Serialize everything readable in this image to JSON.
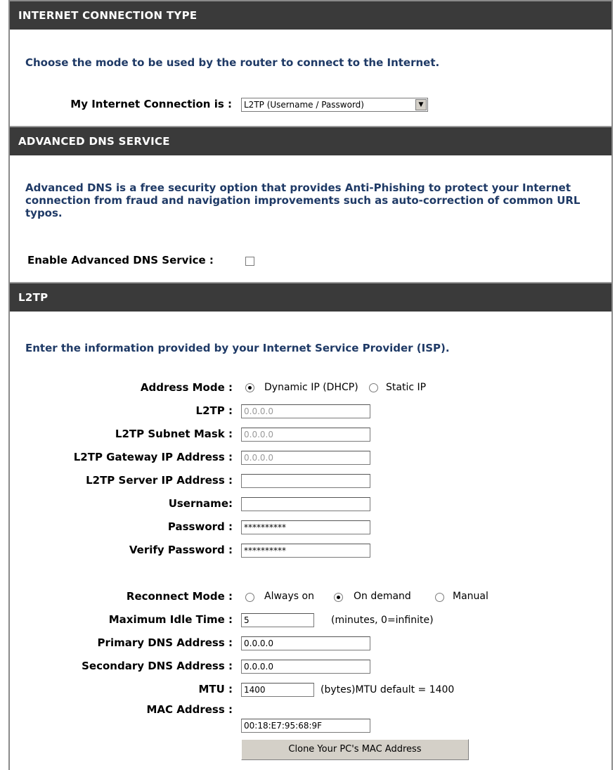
{
  "connection_type": {
    "header": "INTERNET CONNECTION TYPE",
    "description": "Choose the mode to be used by the router to connect to the Internet.",
    "label": "My Internet Connection is :",
    "selected": "L2TP (Username / Password)"
  },
  "advanced_dns": {
    "header": "ADVANCED DNS SERVICE",
    "description": "Advanced DNS is a free security option that provides Anti-Phishing to protect your Internet connection from fraud and navigation improvements such as auto-correction of common URL typos.",
    "label": "Enable Advanced DNS Service :",
    "enabled": false
  },
  "l2tp": {
    "header": "L2TP",
    "description": "Enter the information provided by your Internet Service Provider (ISP).",
    "address_mode": {
      "label": "Address Mode :",
      "options": [
        "Dynamic IP (DHCP)",
        "Static IP"
      ],
      "selected": "Dynamic IP (DHCP)"
    },
    "fields": {
      "l2tp_ip": {
        "label": "L2TP :",
        "value": "0.0.0.0"
      },
      "subnet_mask": {
        "label": "L2TP Subnet Mask :",
        "value": "0.0.0.0"
      },
      "gateway": {
        "label": "L2TP Gateway IP Address :",
        "value": "0.0.0.0"
      },
      "server": {
        "label": "L2TP Server IP Address :",
        "value": ""
      },
      "username": {
        "label": "Username:",
        "value": ""
      },
      "password": {
        "label": "Password :",
        "value": "**********"
      },
      "verify_password": {
        "label": "Verify Password :",
        "value": "**********"
      }
    },
    "reconnect_mode": {
      "label": "Reconnect Mode :",
      "options": [
        "Always on",
        "On demand",
        "Manual"
      ],
      "selected": "On demand"
    },
    "idle_time": {
      "label": "Maximum Idle Time :",
      "value": "5",
      "note": "(minutes, 0=infinite)"
    },
    "primary_dns": {
      "label": "Primary DNS Address :",
      "value": "0.0.0.0"
    },
    "secondary_dns": {
      "label": "Secondary DNS Address :",
      "value": "0.0.0.0"
    },
    "mtu": {
      "label": "MTU :",
      "value": "1400",
      "note": "(bytes)MTU default = 1400"
    },
    "mac": {
      "label": "MAC Address :",
      "value": "00:18:E7:95:68:9F"
    },
    "clone_button": "Clone Your PC's MAC Address"
  },
  "colors": {
    "header_bg": "#3a3a3a",
    "description_text": "#1f3a66"
  }
}
